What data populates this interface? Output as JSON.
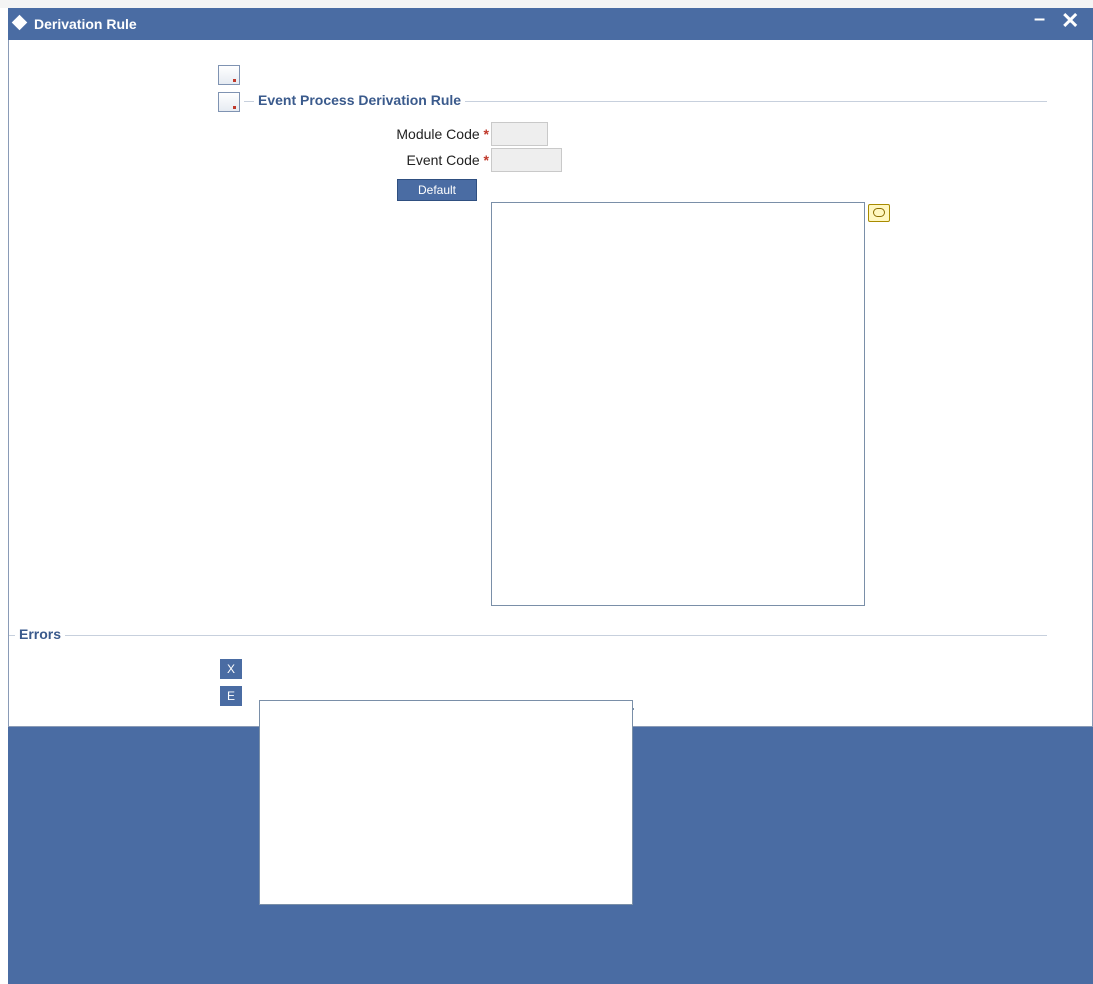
{
  "window": {
    "title": "Derivation Rule",
    "minimize_label": "–",
    "close_label": "✕"
  },
  "toolbar": {
    "icons": [
      "document-icon",
      "document-icon"
    ]
  },
  "event_section": {
    "title": "Event Process Derivation Rule",
    "module_code": {
      "label": "Module Code",
      "required": "*",
      "value": ""
    },
    "event_code": {
      "label": "Event Code",
      "required": "*",
      "value": ""
    },
    "default_button": "Default"
  },
  "errors_section": {
    "title": "Errors",
    "x_button": "X",
    "e_button": "E"
  },
  "colors": {
    "accent": "#4a6ca3",
    "required": "#c0392b",
    "section_title": "#3a5a8c"
  }
}
